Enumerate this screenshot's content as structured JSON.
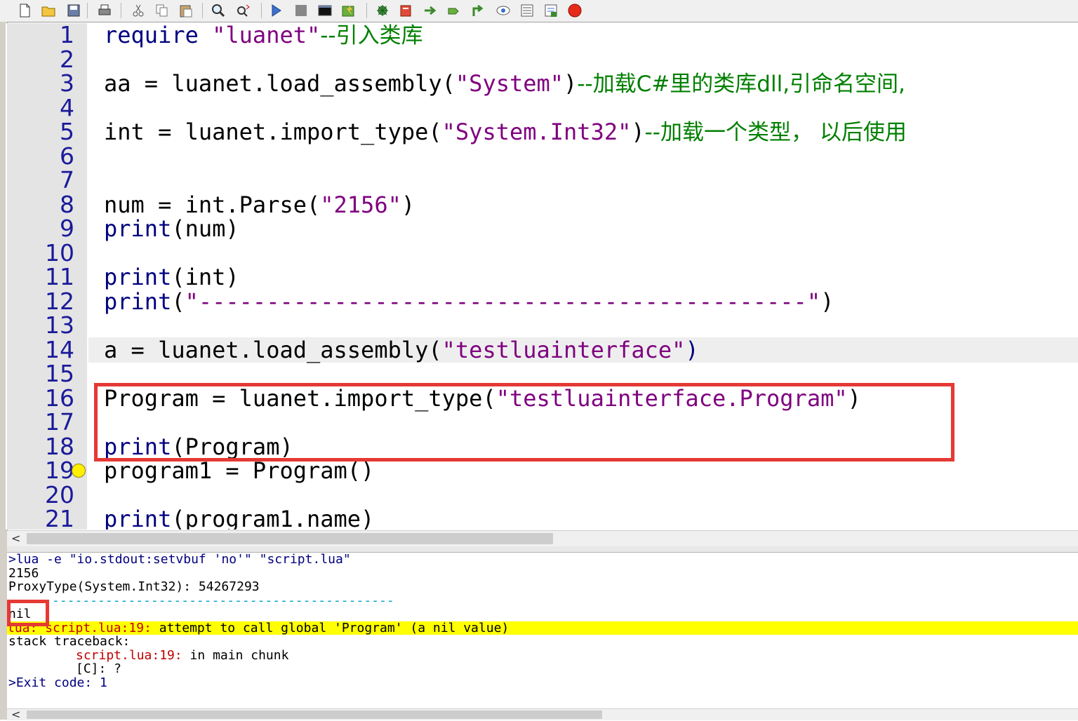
{
  "toolbar": {
    "buttons": [
      {
        "name": "new-file-icon"
      },
      {
        "name": "open-folder-icon"
      },
      {
        "name": "save-icon"
      },
      {
        "name": "print-icon"
      },
      {
        "name": "cut-icon"
      },
      {
        "name": "copy-icon"
      },
      {
        "name": "paste-icon"
      },
      {
        "name": "find-icon"
      },
      {
        "name": "replace-icon"
      },
      {
        "name": "run-icon"
      },
      {
        "name": "stop-icon"
      },
      {
        "name": "console-icon"
      },
      {
        "name": "compile-icon"
      },
      {
        "name": "debug-icon"
      },
      {
        "name": "breakpoint-icon"
      },
      {
        "name": "step-over-icon"
      },
      {
        "name": "step-into-icon"
      },
      {
        "name": "step-out-icon"
      },
      {
        "name": "watch-icon"
      },
      {
        "name": "stack-icon"
      },
      {
        "name": "output-icon"
      },
      {
        "name": "record-icon"
      }
    ]
  },
  "editor": {
    "line_numbers": [
      "1",
      "2",
      "3",
      "4",
      "5",
      "6",
      "7",
      "8",
      "9",
      "10",
      "11",
      "12",
      "13",
      "14",
      "15",
      "16",
      "17",
      "18",
      "19",
      "20",
      "21"
    ],
    "lines": {
      "l1": {
        "a": "require ",
        "s": "\"luanet\"",
        "c": "--引入类库"
      },
      "l3": {
        "a": "aa = luanet.load_assembly(",
        "s": "\"System\"",
        "b": ")",
        "c": "--加载C#里的类库dll,引命名空间,"
      },
      "l5": {
        "k": "int",
        " a": "",
        "a": " = luanet.import_type(",
        "s": "\"System.Int32\"",
        "b": ")",
        "c": "--加载一个类型， 以后使用"
      },
      "l8": {
        "a": "num = int.Parse(",
        "s": "\"2156\"",
        "b": ")"
      },
      "l9": {
        "k": "print",
        "a": "(num)"
      },
      "l11": {
        "k": "print",
        "a": "(int)"
      },
      "l12": {
        "k": "print",
        "a": "(",
        "s": "\"---------------------------------------------\"",
        "b": ")"
      },
      "l14": {
        "a": "a = luanet.load_assembly(",
        "s": "\"testluainterface\"",
        "b": ")"
      },
      "l16": {
        "a": "Program = luanet.import_type(",
        "s": "\"testluainterface.Program\"",
        "b": ")"
      },
      "l18": {
        "k": "print",
        "a": "(Program)"
      },
      "l19": {
        "a": "program1 = Program()"
      },
      "l21": {
        "k": "print",
        "a": "(program1.name)"
      }
    }
  },
  "output": {
    "cmd_prefix": ">lua -e ",
    "cmd_str": "\"io.stdout:setvbuf 'no'\" \"script.lua\"",
    "line2": "2156",
    "line3": "ProxyType(System.Int32): 54267293",
    "line4": "---------------------------------------------",
    "line5": "nil",
    "err_prefix": "lua: ",
    "err_loc": "script.lua:19:",
    "err_msg": " attempt to call global 'Program' (a nil value)",
    "line7": "stack traceback:",
    "tb1_loc": "script.lua:19:",
    "tb1_msg": " in main chunk",
    "tb2": "[C]: ?",
    "exit": ">Exit code: 1"
  },
  "colors": {
    "highlight_box": "#e53935",
    "error_bg": "#ffff00",
    "keyword": "#00007f",
    "string": "#7f007f",
    "comment": "#007f00"
  }
}
